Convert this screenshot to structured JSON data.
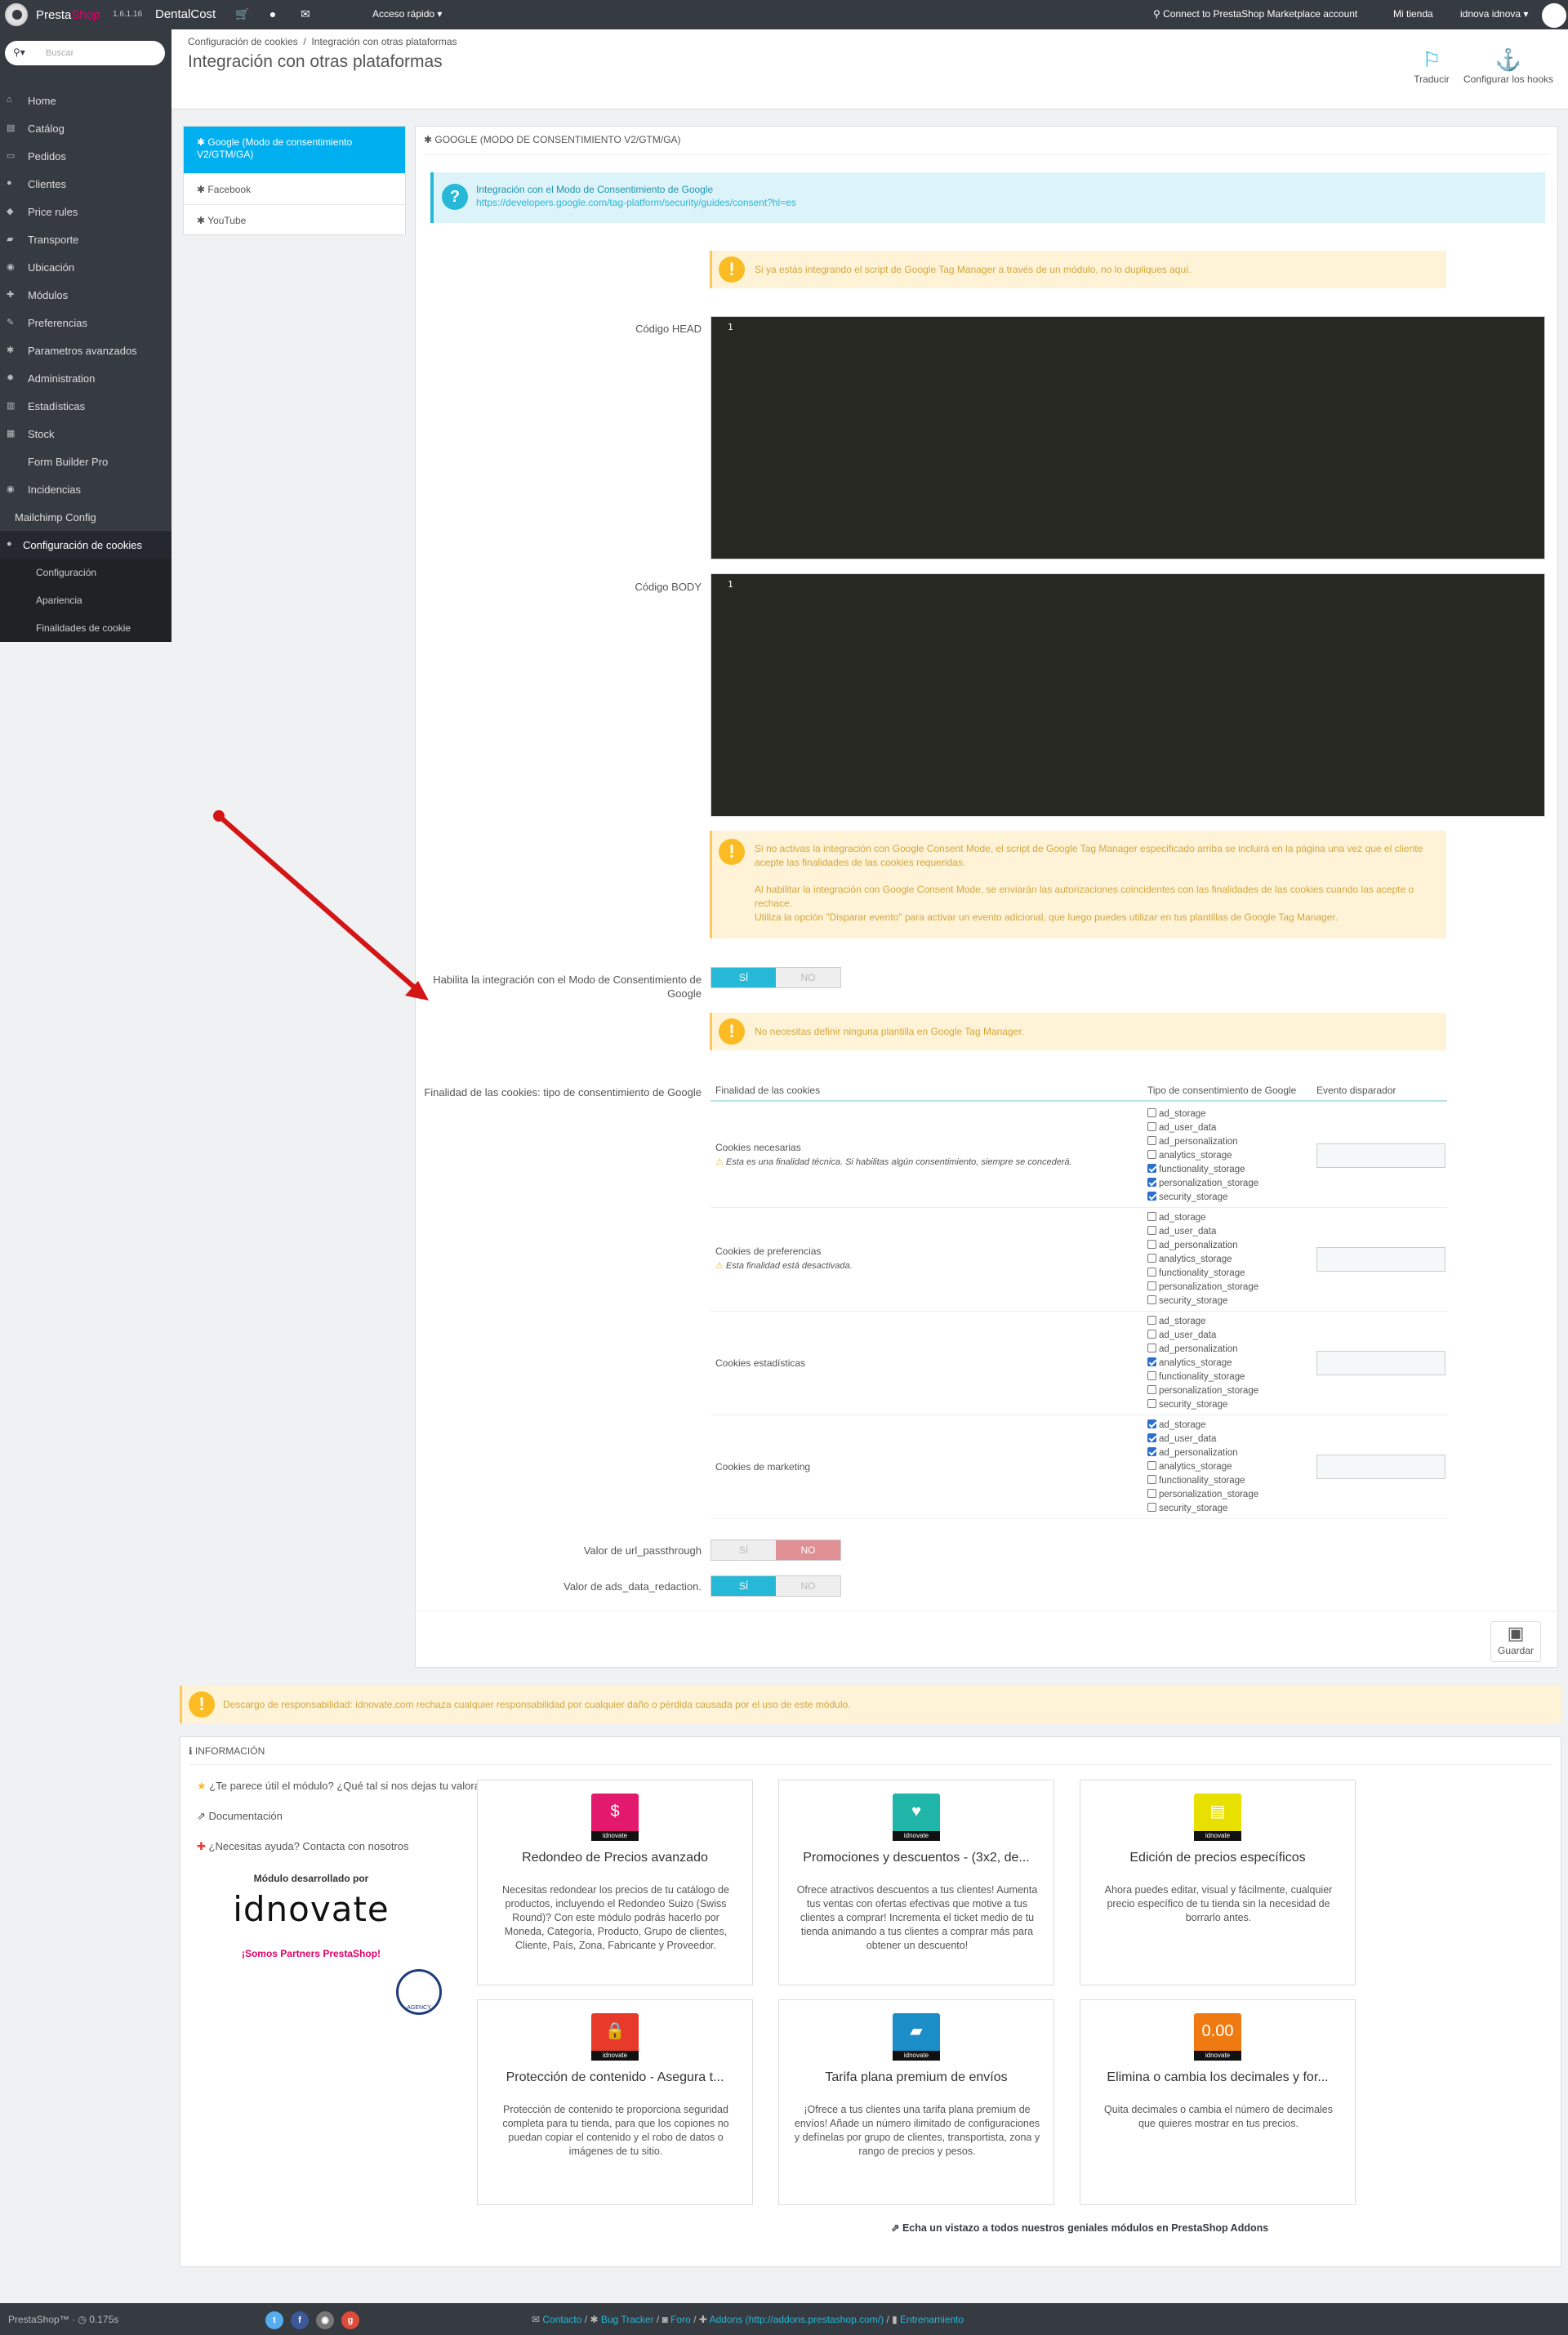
{
  "topbar": {
    "brand_a": "Presta",
    "brand_b": "Shop",
    "version": "1.6.1.16",
    "shop_name": "DentalCost",
    "quick_access": "Acceso rápido ▾",
    "marketplace": "Connect to PrestaShop Marketplace account",
    "my_store": "Mi tienda",
    "employee": "idnova idnova ▾"
  },
  "sidebar": {
    "search_placeholder": "Buscar",
    "items": [
      {
        "label": "Home",
        "icon": "home-icon",
        "glyph": "⌂"
      },
      {
        "label": "Catálog",
        "icon": "catalog-icon",
        "glyph": "▤"
      },
      {
        "label": "Pedidos",
        "icon": "orders-icon",
        "glyph": "▭"
      },
      {
        "label": "Clientes",
        "icon": "customers-icon",
        "glyph": "●"
      },
      {
        "label": "Price rules",
        "icon": "price-rules-icon",
        "glyph": "◆"
      },
      {
        "label": "Transporte",
        "icon": "truck-icon",
        "glyph": "▰"
      },
      {
        "label": "Ubicación",
        "icon": "globe-icon",
        "glyph": "◉"
      },
      {
        "label": "Módulos",
        "icon": "puzzle-icon",
        "glyph": "✚"
      },
      {
        "label": "Preferencias",
        "icon": "wrench-icon",
        "glyph": "✎"
      },
      {
        "label": "Parametros avanzados",
        "icon": "cogs-icon",
        "glyph": "✱"
      },
      {
        "label": "Administration",
        "icon": "gear-icon",
        "glyph": "✹"
      },
      {
        "label": "Estadísticas",
        "icon": "chart-icon",
        "glyph": "▥"
      },
      {
        "label": "Stock",
        "icon": "stock-icon",
        "glyph": "▦"
      },
      {
        "label": "Form Builder Pro",
        "icon": "",
        "glyph": ""
      },
      {
        "label": "Incidencias",
        "icon": "alert-icon",
        "glyph": "◉"
      },
      {
        "label": "Mailchimp Config",
        "icon": "",
        "glyph": ""
      },
      {
        "label": "Configuración de cookies",
        "icon": "cookie-icon",
        "glyph": "●"
      }
    ],
    "subitems": [
      "Configuración",
      "Apariencia",
      "Finalidades de cookie"
    ]
  },
  "header": {
    "breadcrumb_1": "Configuración de cookies",
    "breadcrumb_sep": "/",
    "breadcrumb_2": "Integración con otras plataformas",
    "title": "Integración con otras plataformas",
    "btn_translate": "Traducir",
    "btn_hooks": "Configurar los hooks"
  },
  "tabs": [
    {
      "label": "Google (Modo de consentimiento V2/GTM/GA)"
    },
    {
      "label": "Facebook"
    },
    {
      "label": "YouTube"
    }
  ],
  "panel": {
    "heading": "GOOGLE (MODO DE CONSENTIMIENTO V2/GTM/GA)",
    "info_line1": "Integración con el Modo de Consentimiento de Google",
    "info_link": "https://developers.google.com/tag-platform/security/guides/consent?hl=es",
    "warn_gtm": "Si ya estás integrando el script de Google Tag Manager a través de un módulo, no lo dupliques aquí.",
    "label_head": "Código HEAD",
    "label_body": "Código BODY",
    "line_number": "1",
    "warn_consent_1": "Si no activas la integración con Google Consent Mode, el script de Google Tag Manager especificado arriba se incluirá en la página una vez que el cliente acepte las finalidades de las cookies requeridas.",
    "warn_consent_2": "Al habilitar la integración con Google Consent Mode, se enviarán las autorizaciones coincidentes con las finalidades de las cookies cuando las acepte o rechace.",
    "warn_consent_3": "Utiliza la opción \"Disparar evento\" para activar un evento adicional, que luego puedes utilizar en tus plantillas de Google Tag Manager.",
    "label_enable": "Habilita la integración con el Modo de Consentimiento de Google",
    "warn_template": "No necesitas definir ninguna plantilla en Google Tag Manager.",
    "label_purposes": "Finalidad de las cookies: tipo de consentimiento de Google",
    "col_purpose": "Finalidad de las cookies",
    "col_consent": "Tipo de consentimiento de Google",
    "col_event": "Evento disparador",
    "label_url_passthrough": "Valor de url_passthrough",
    "label_ads_redaction": "Valor de ads_data_redaction.",
    "yes": "SÍ",
    "no": "NO",
    "save": "Guardar"
  },
  "switches": {
    "enable_consent_mode": "yes",
    "url_passthrough": "no",
    "ads_data_redaction": "yes"
  },
  "consent_types": [
    "ad_storage",
    "ad_user_data",
    "ad_personalization",
    "analytics_storage",
    "functionality_storage",
    "personalization_storage",
    "security_storage"
  ],
  "purposes": [
    {
      "name": "Cookies necesarias",
      "note": "Esta es una finalidad técnica. Si habilitas algún consentimiento, siempre se concederá.",
      "checked": [
        false,
        false,
        false,
        false,
        true,
        true,
        true
      ]
    },
    {
      "name": "Cookies de preferencias",
      "note": "Esta finalidad está desactivada.",
      "checked": [
        false,
        false,
        false,
        false,
        false,
        false,
        false
      ]
    },
    {
      "name": "Cookies estadísticas",
      "note": "",
      "checked": [
        false,
        false,
        false,
        true,
        false,
        false,
        false
      ]
    },
    {
      "name": "Cookies de marketing",
      "note": "",
      "checked": [
        true,
        true,
        true,
        false,
        false,
        false,
        false
      ]
    }
  ],
  "disclaimer": "Descargo de responsabilidad: idnovate.com rechaza cualquier responsabilidad por cualquier daño o pérdida causada por el uso de este módulo.",
  "info": {
    "heading": "INFORMACIÓN",
    "link_rate": "¿Te parece útil el módulo? ¿Qué tal si nos dejas tu valoración en Addons?",
    "link_docs": "Documentación",
    "link_help": "¿Necesitas ayuda? Contacta con nosotros",
    "developed_by": "Módulo desarrollado por",
    "logo_text": "idnovate",
    "partners": "¡Somos Partners PrestaShop!",
    "badge_text": "AGENCY",
    "addons_link": "Echa un vistazo a todos nuestros geniales módulos en PrestaShop Addons",
    "cards": [
      {
        "title": "Redondeo de Precios avanzado",
        "desc": "Necesitas redondear los precios de tu catálogo de productos, incluyendo el Redondeo Suizo (Swiss Round)? Con este módulo podrás hacerlo por Moneda, Categoría, Producto, Grupo de clientes, Cliente, País, Zona, Fabricante y Proveedor.",
        "color": "#e3196e",
        "glyph": "$",
        "brand": "idnovate"
      },
      {
        "title": "Promociones y descuentos - (3x2, de...",
        "desc": "Ofrece atractivos descuentos a tus clientes! Aumenta tus ventas con ofertas efectivas que motive a tus clientes a comprar! Incrementa el ticket medio de tu tienda animando a tus clientes a comprar más para obtener un descuento!",
        "color": "#1fb5a8",
        "glyph": "♥",
        "brand": "idnovate"
      },
      {
        "title": "Edición de precios específicos",
        "desc": "Ahora puedes editar, visual y fácilmente, cualquier precio específico de tu tienda sin la necesidad de borrarlo antes.",
        "color": "#e8e000",
        "glyph": "▤",
        "brand": "idnovate"
      },
      {
        "title": "Protección de contenido - Asegura t...",
        "desc": "Protección de contenido te proporciona seguridad completa para tu tienda, para que los copiones no puedan copiar el contenido y el robo de datos o imágenes de tu sitio.",
        "color": "#e83a2b",
        "glyph": "🔒",
        "brand": "idnovate"
      },
      {
        "title": "Tarifa plana premium de envíos",
        "desc": "¡Ofrece a tus clientes una tarifa plana premium de envíos! Añade un número ilimitado de configuraciones y defínelas por grupo de clientes, transportista, zona y rango de precios y pesos.",
        "color": "#1c8ec7",
        "glyph": "▰",
        "brand": "idnovate"
      },
      {
        "title": "Elimina o cambia los decimales y for...",
        "desc": "Quita decimales o cambia el número de decimales que quieres mostrar en tus precios.",
        "color": "#f07a12",
        "glyph": "0.00",
        "brand": "idnovate"
      }
    ]
  },
  "footer": {
    "brand": "PrestaShop™",
    "sep": "·",
    "time": "0.175s",
    "contact": "Contacto",
    "bug": "Bug Tracker",
    "forum": "Foro",
    "addons": "Addons (http://addons.prestashop.com/)",
    "training": "Entrenamiento",
    "slash": "/"
  },
  "colors": {
    "accent": "#25b9d7",
    "sidebar": "#363a41",
    "tab_active": "#00aff0",
    "warning": "#fbbb22",
    "arrow": "#d31515"
  }
}
